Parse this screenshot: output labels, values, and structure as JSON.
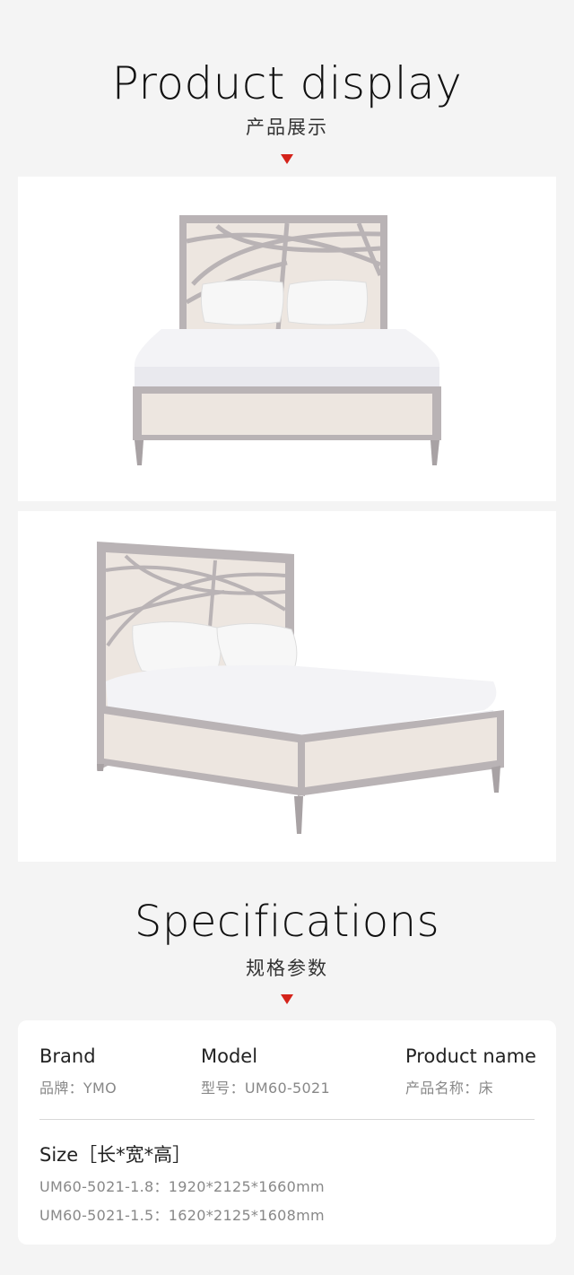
{
  "display": {
    "title": "Product display",
    "subtitle": "产品展示"
  },
  "photos": [
    {
      "name": "front-view",
      "alt": "bed front view"
    },
    {
      "name": "angle-view",
      "alt": "bed angled view"
    }
  ],
  "specifications": {
    "title": "Specifications",
    "subtitle": "规格参数",
    "brand_label": "Brand",
    "brand_value": "品牌：YMO",
    "model_label": "Model",
    "model_value": "型号：UM60-5021",
    "name_label": "Product name",
    "name_value": "产品名称：床",
    "size_label": "Size［长*宽*高］",
    "sizes": [
      "UM60-5021-1.8：1920*2125*1660mm",
      "UM60-5021-1.5：1620*2125*1608mm"
    ]
  },
  "colors": {
    "accent": "#d4231a",
    "background": "#f4f4f4",
    "frame": "#b8b2b4",
    "upholstery": "#ece5df"
  }
}
